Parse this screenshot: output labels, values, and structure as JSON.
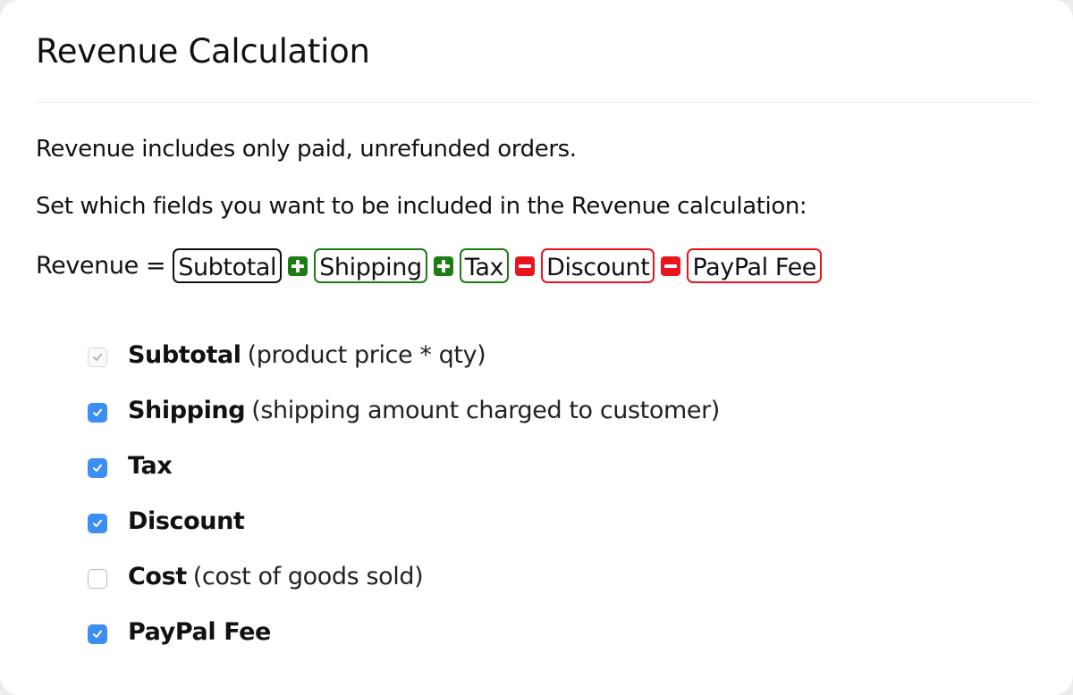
{
  "header": {
    "title": "Revenue Calculation"
  },
  "intro": {
    "line1": "Revenue includes only paid, unrefunded orders.",
    "line2": "Set which fields you want to be included in the Revenue calculation:"
  },
  "formula": {
    "lhs": "Revenue =",
    "terms": [
      {
        "label": "Subtotal",
        "operator": null,
        "style": "neutral"
      },
      {
        "label": "Shipping",
        "operator": "plus-icon",
        "style": "plus"
      },
      {
        "label": "Tax",
        "operator": "plus-icon",
        "style": "plus"
      },
      {
        "label": "Discount",
        "operator": "minus-icon",
        "style": "minus"
      },
      {
        "label": "PayPal Fee",
        "operator": "minus-icon",
        "style": "minus"
      }
    ],
    "colors": {
      "plus": "#1b7d14",
      "minus": "#e8141e",
      "neutral": "#111111"
    }
  },
  "options": [
    {
      "label": "Subtotal",
      "description": "(product price * qty)",
      "checked": true,
      "disabled": true
    },
    {
      "label": "Shipping",
      "description": "(shipping amount charged to customer)",
      "checked": true,
      "disabled": false
    },
    {
      "label": "Tax",
      "description": "",
      "checked": true,
      "disabled": false
    },
    {
      "label": "Discount",
      "description": "",
      "checked": true,
      "disabled": false
    },
    {
      "label": "Cost",
      "description": "(cost of goods sold)",
      "checked": false,
      "disabled": false
    },
    {
      "label": "PayPal Fee",
      "description": "",
      "checked": true,
      "disabled": false
    }
  ],
  "colors": {
    "checkbox_checked": "#3d8ef2"
  }
}
